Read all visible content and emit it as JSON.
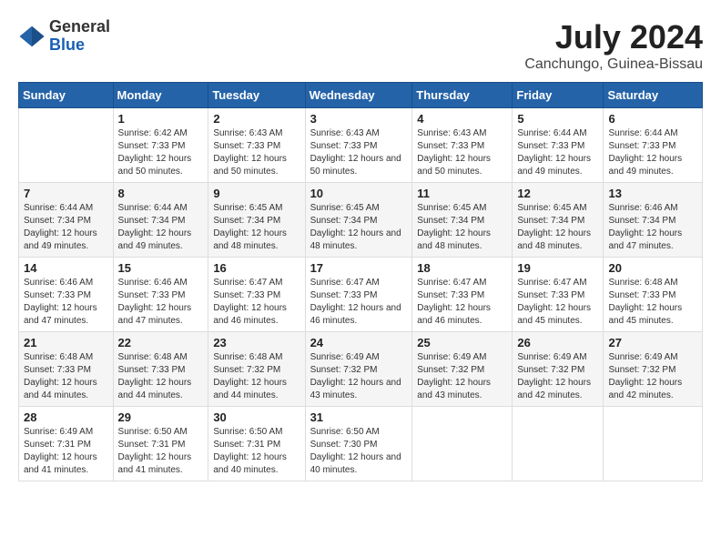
{
  "logo": {
    "general": "General",
    "blue": "Blue"
  },
  "header": {
    "month_year": "July 2024",
    "location": "Canchungo, Guinea-Bissau"
  },
  "columns": [
    "Sunday",
    "Monday",
    "Tuesday",
    "Wednesday",
    "Thursday",
    "Friday",
    "Saturday"
  ],
  "weeks": [
    [
      {
        "day": "",
        "sunrise": "",
        "sunset": "",
        "daylight": ""
      },
      {
        "day": "1",
        "sunrise": "Sunrise: 6:42 AM",
        "sunset": "Sunset: 7:33 PM",
        "daylight": "Daylight: 12 hours and 50 minutes."
      },
      {
        "day": "2",
        "sunrise": "Sunrise: 6:43 AM",
        "sunset": "Sunset: 7:33 PM",
        "daylight": "Daylight: 12 hours and 50 minutes."
      },
      {
        "day": "3",
        "sunrise": "Sunrise: 6:43 AM",
        "sunset": "Sunset: 7:33 PM",
        "daylight": "Daylight: 12 hours and 50 minutes."
      },
      {
        "day": "4",
        "sunrise": "Sunrise: 6:43 AM",
        "sunset": "Sunset: 7:33 PM",
        "daylight": "Daylight: 12 hours and 50 minutes."
      },
      {
        "day": "5",
        "sunrise": "Sunrise: 6:44 AM",
        "sunset": "Sunset: 7:33 PM",
        "daylight": "Daylight: 12 hours and 49 minutes."
      },
      {
        "day": "6",
        "sunrise": "Sunrise: 6:44 AM",
        "sunset": "Sunset: 7:33 PM",
        "daylight": "Daylight: 12 hours and 49 minutes."
      }
    ],
    [
      {
        "day": "7",
        "sunrise": "Sunrise: 6:44 AM",
        "sunset": "Sunset: 7:34 PM",
        "daylight": "Daylight: 12 hours and 49 minutes."
      },
      {
        "day": "8",
        "sunrise": "Sunrise: 6:44 AM",
        "sunset": "Sunset: 7:34 PM",
        "daylight": "Daylight: 12 hours and 49 minutes."
      },
      {
        "day": "9",
        "sunrise": "Sunrise: 6:45 AM",
        "sunset": "Sunset: 7:34 PM",
        "daylight": "Daylight: 12 hours and 48 minutes."
      },
      {
        "day": "10",
        "sunrise": "Sunrise: 6:45 AM",
        "sunset": "Sunset: 7:34 PM",
        "daylight": "Daylight: 12 hours and 48 minutes."
      },
      {
        "day": "11",
        "sunrise": "Sunrise: 6:45 AM",
        "sunset": "Sunset: 7:34 PM",
        "daylight": "Daylight: 12 hours and 48 minutes."
      },
      {
        "day": "12",
        "sunrise": "Sunrise: 6:45 AM",
        "sunset": "Sunset: 7:34 PM",
        "daylight": "Daylight: 12 hours and 48 minutes."
      },
      {
        "day": "13",
        "sunrise": "Sunrise: 6:46 AM",
        "sunset": "Sunset: 7:34 PM",
        "daylight": "Daylight: 12 hours and 47 minutes."
      }
    ],
    [
      {
        "day": "14",
        "sunrise": "Sunrise: 6:46 AM",
        "sunset": "Sunset: 7:33 PM",
        "daylight": "Daylight: 12 hours and 47 minutes."
      },
      {
        "day": "15",
        "sunrise": "Sunrise: 6:46 AM",
        "sunset": "Sunset: 7:33 PM",
        "daylight": "Daylight: 12 hours and 47 minutes."
      },
      {
        "day": "16",
        "sunrise": "Sunrise: 6:47 AM",
        "sunset": "Sunset: 7:33 PM",
        "daylight": "Daylight: 12 hours and 46 minutes."
      },
      {
        "day": "17",
        "sunrise": "Sunrise: 6:47 AM",
        "sunset": "Sunset: 7:33 PM",
        "daylight": "Daylight: 12 hours and 46 minutes."
      },
      {
        "day": "18",
        "sunrise": "Sunrise: 6:47 AM",
        "sunset": "Sunset: 7:33 PM",
        "daylight": "Daylight: 12 hours and 46 minutes."
      },
      {
        "day": "19",
        "sunrise": "Sunrise: 6:47 AM",
        "sunset": "Sunset: 7:33 PM",
        "daylight": "Daylight: 12 hours and 45 minutes."
      },
      {
        "day": "20",
        "sunrise": "Sunrise: 6:48 AM",
        "sunset": "Sunset: 7:33 PM",
        "daylight": "Daylight: 12 hours and 45 minutes."
      }
    ],
    [
      {
        "day": "21",
        "sunrise": "Sunrise: 6:48 AM",
        "sunset": "Sunset: 7:33 PM",
        "daylight": "Daylight: 12 hours and 44 minutes."
      },
      {
        "day": "22",
        "sunrise": "Sunrise: 6:48 AM",
        "sunset": "Sunset: 7:33 PM",
        "daylight": "Daylight: 12 hours and 44 minutes."
      },
      {
        "day": "23",
        "sunrise": "Sunrise: 6:48 AM",
        "sunset": "Sunset: 7:32 PM",
        "daylight": "Daylight: 12 hours and 44 minutes."
      },
      {
        "day": "24",
        "sunrise": "Sunrise: 6:49 AM",
        "sunset": "Sunset: 7:32 PM",
        "daylight": "Daylight: 12 hours and 43 minutes."
      },
      {
        "day": "25",
        "sunrise": "Sunrise: 6:49 AM",
        "sunset": "Sunset: 7:32 PM",
        "daylight": "Daylight: 12 hours and 43 minutes."
      },
      {
        "day": "26",
        "sunrise": "Sunrise: 6:49 AM",
        "sunset": "Sunset: 7:32 PM",
        "daylight": "Daylight: 12 hours and 42 minutes."
      },
      {
        "day": "27",
        "sunrise": "Sunrise: 6:49 AM",
        "sunset": "Sunset: 7:32 PM",
        "daylight": "Daylight: 12 hours and 42 minutes."
      }
    ],
    [
      {
        "day": "28",
        "sunrise": "Sunrise: 6:49 AM",
        "sunset": "Sunset: 7:31 PM",
        "daylight": "Daylight: 12 hours and 41 minutes."
      },
      {
        "day": "29",
        "sunrise": "Sunrise: 6:50 AM",
        "sunset": "Sunset: 7:31 PM",
        "daylight": "Daylight: 12 hours and 41 minutes."
      },
      {
        "day": "30",
        "sunrise": "Sunrise: 6:50 AM",
        "sunset": "Sunset: 7:31 PM",
        "daylight": "Daylight: 12 hours and 40 minutes."
      },
      {
        "day": "31",
        "sunrise": "Sunrise: 6:50 AM",
        "sunset": "Sunset: 7:30 PM",
        "daylight": "Daylight: 12 hours and 40 minutes."
      },
      {
        "day": "",
        "sunrise": "",
        "sunset": "",
        "daylight": ""
      },
      {
        "day": "",
        "sunrise": "",
        "sunset": "",
        "daylight": ""
      },
      {
        "day": "",
        "sunrise": "",
        "sunset": "",
        "daylight": ""
      }
    ]
  ]
}
